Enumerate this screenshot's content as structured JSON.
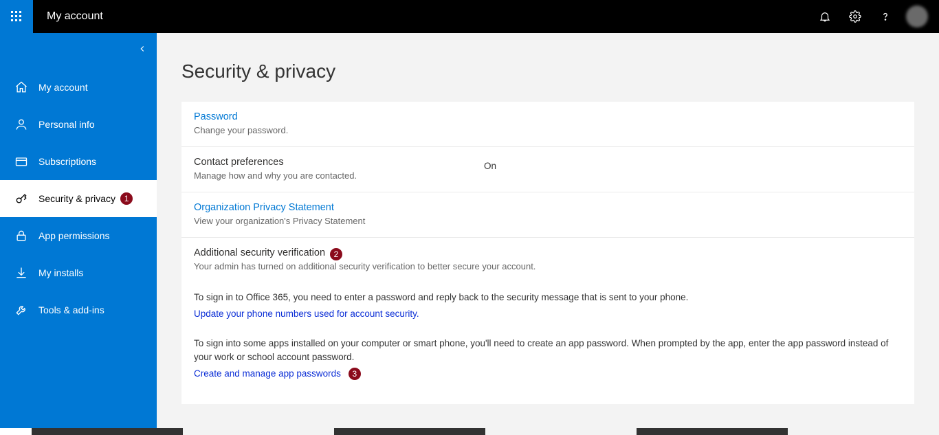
{
  "header": {
    "title": "My account"
  },
  "sidebar": {
    "items": [
      {
        "label": "My account"
      },
      {
        "label": "Personal info"
      },
      {
        "label": "Subscriptions"
      },
      {
        "label": "Security & privacy",
        "badge": "1"
      },
      {
        "label": "App permissions"
      },
      {
        "label": "My installs"
      },
      {
        "label": "Tools & add-ins"
      }
    ]
  },
  "page": {
    "title": "Security & privacy",
    "password": {
      "title": "Password",
      "sub": "Change your password."
    },
    "contact": {
      "title": "Contact preferences",
      "sub": "Manage how and why you are contacted.",
      "value": "On"
    },
    "org": {
      "title": "Organization Privacy Statement",
      "sub": "View your organization's Privacy Statement"
    },
    "asv": {
      "title": "Additional security verification",
      "badge": "2",
      "sub": "Your admin has turned on additional security verification to better secure your account.",
      "p1": "To sign in to Office 365, you need to enter a password and reply back to the security message that is sent to your phone.",
      "link1": "Update your phone numbers used for account security.",
      "p2": "To sign into some apps installed on your computer or smart phone, you'll need to create an app password. When prompted by the app, enter the app password instead of your work or school account password.",
      "link2": "Create and manage app passwords",
      "badge2": "3"
    }
  }
}
